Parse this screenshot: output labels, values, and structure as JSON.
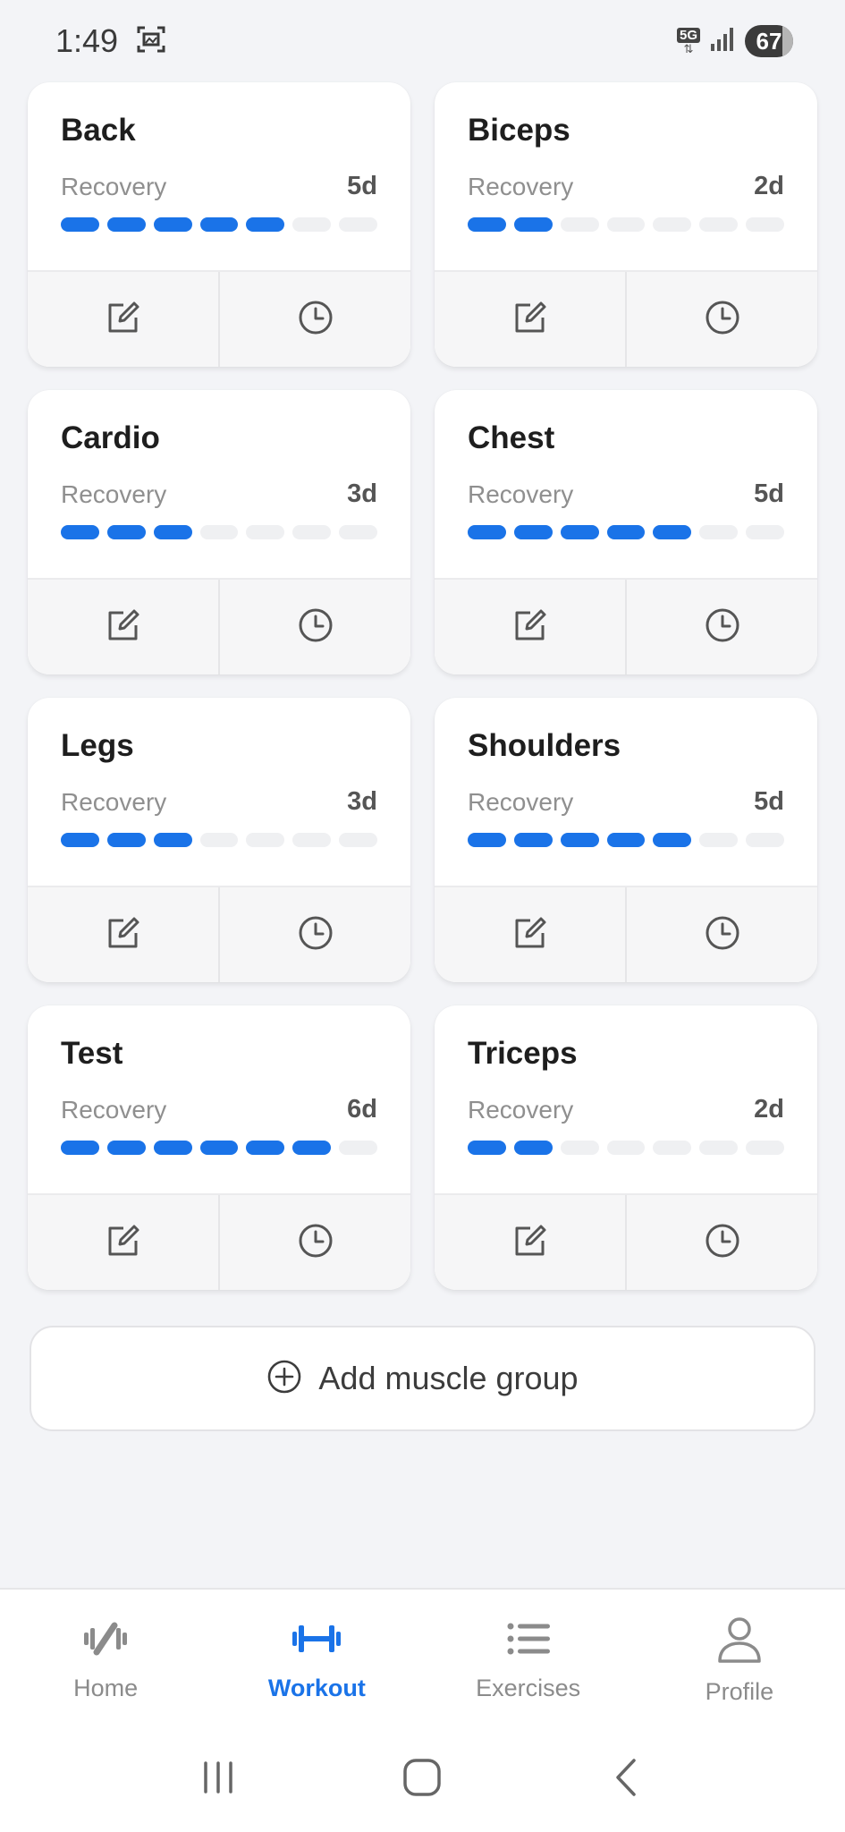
{
  "status_bar": {
    "time": "1:49",
    "network": "5G",
    "battery": "67"
  },
  "accent_color": "#1a73e8",
  "recovery_label": "Recovery",
  "muscle_groups": [
    {
      "name": "Back",
      "recovery": "5d",
      "level": 5,
      "max": 7
    },
    {
      "name": "Biceps",
      "recovery": "2d",
      "level": 2,
      "max": 7
    },
    {
      "name": "Cardio",
      "recovery": "3d",
      "level": 3,
      "max": 7
    },
    {
      "name": "Chest",
      "recovery": "5d",
      "level": 5,
      "max": 7
    },
    {
      "name": "Legs",
      "recovery": "3d",
      "level": 3,
      "max": 7
    },
    {
      "name": "Shoulders",
      "recovery": "5d",
      "level": 5,
      "max": 7
    },
    {
      "name": "Test",
      "recovery": "6d",
      "level": 6,
      "max": 7
    },
    {
      "name": "Triceps",
      "recovery": "2d",
      "level": 2,
      "max": 7
    }
  ],
  "card_actions": {
    "edit_icon": "edit-icon",
    "history_icon": "clock-icon"
  },
  "add_button": {
    "label": "Add muscle group",
    "icon": "plus-circle-icon"
  },
  "bottom_nav": {
    "items": [
      {
        "label": "Home",
        "icon": "home-icon",
        "active": false
      },
      {
        "label": "Workout",
        "icon": "dumbbell-icon",
        "active": true
      },
      {
        "label": "Exercises",
        "icon": "list-icon",
        "active": false
      },
      {
        "label": "Profile",
        "icon": "person-icon",
        "active": false
      }
    ]
  },
  "system_nav": [
    "recents-icon",
    "home-button-icon",
    "back-icon"
  ]
}
